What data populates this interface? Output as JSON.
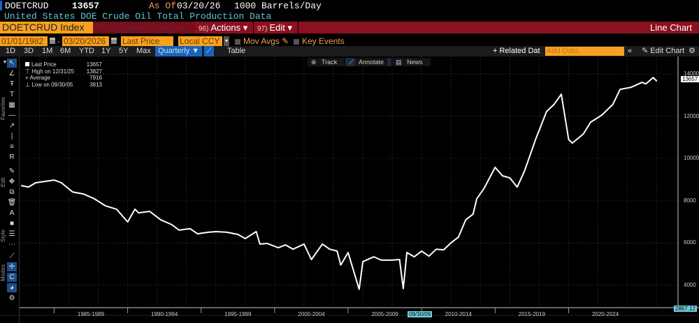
{
  "header": {
    "ticker": "DOETCRUD",
    "last": "13657",
    "as_of_label": "As Of",
    "as_of_date": "03/20/26",
    "units": "1000 Barrels/Day",
    "subtitle": "United States DOE Crude Oil Total Production Data"
  },
  "menubar": {
    "security": "DOETCRUD Index",
    "suggested_num": "94)",
    "suggested": "Suggested Charts",
    "actions_num": "96)",
    "actions": "Actions",
    "edit_num": "97)",
    "edit": "Edit",
    "chart_type": "Line Chart"
  },
  "controls": {
    "start_date": "01/01/1982",
    "end_date": "03/20/2026",
    "field": "Last Price",
    "currency": "Local CCY",
    "mov_avgs": "Mov Avgs",
    "key_events": "Key Events"
  },
  "periods": [
    "1D",
    "3D",
    "1M",
    "6M",
    "YTD",
    "1Y",
    "5Y",
    "Max"
  ],
  "frequency": "Quarterly ▼",
  "table_label": "Table",
  "related": "+ Related Dat",
  "add_data_placeholder": "Add Data",
  "edit_chart": "Edit Chart",
  "chart_tools": {
    "track": "Track",
    "annotate": "Annotate",
    "news": "News"
  },
  "side_labels": {
    "favorites": "Favorites",
    "edit": "Edit",
    "style": "Style",
    "modes": "Modes"
  },
  "legend": {
    "last_label": "Last Price",
    "last": "13657",
    "high_label": "High on 12/31/25",
    "high": "13827",
    "avg_label": "Average",
    "avg": "7916",
    "low_label": "Low on 09/30/05",
    "low": "3813"
  },
  "crosshair": {
    "x_label": "09/30/09",
    "y_label": "2867.12"
  },
  "chart_data": {
    "type": "line",
    "series_name": "Last Price",
    "line_color": "#ffffff",
    "ylim": [
      2500,
      14600
    ],
    "yticks": [
      4000,
      6000,
      8000,
      10000,
      12000,
      14000
    ],
    "xlim": [
      1982.0,
      2026.7
    ],
    "xticks": [
      "1985-1989",
      "1990-1994",
      "1995-1999",
      "2000-2004",
      "2005-2009",
      "2010-2014",
      "2015-2019",
      "2020-2024"
    ],
    "last_value_label": "13657",
    "points": [
      [
        1982.75,
        8720
      ],
      [
        1983.25,
        8650
      ],
      [
        1983.75,
        8850
      ],
      [
        1985.0,
        8980
      ],
      [
        1985.5,
        8850
      ],
      [
        1986.25,
        8420
      ],
      [
        1987.0,
        8320
      ],
      [
        1987.75,
        8090
      ],
      [
        1988.5,
        7760
      ],
      [
        1989.25,
        7600
      ],
      [
        1990.0,
        7000
      ],
      [
        1990.5,
        7600
      ],
      [
        1990.75,
        7430
      ],
      [
        1991.5,
        7500
      ],
      [
        1992.25,
        7100
      ],
      [
        1993.0,
        6870
      ],
      [
        1993.5,
        6610
      ],
      [
        1994.25,
        6680
      ],
      [
        1994.75,
        6440
      ],
      [
        1995.5,
        6510
      ],
      [
        1996.0,
        6540
      ],
      [
        1996.75,
        6510
      ],
      [
        1997.5,
        6410
      ],
      [
        1998.0,
        6210
      ],
      [
        1998.75,
        6540
      ],
      [
        1999.0,
        5950
      ],
      [
        1999.5,
        5980
      ],
      [
        2000.25,
        5780
      ],
      [
        2000.75,
        5910
      ],
      [
        2001.25,
        5710
      ],
      [
        2002.0,
        5950
      ],
      [
        2002.5,
        5220
      ],
      [
        2003.25,
        5950
      ],
      [
        2003.75,
        5710
      ],
      [
        2004.25,
        5620
      ],
      [
        2004.5,
        4960
      ],
      [
        2005.0,
        5550
      ],
      [
        2005.75,
        3813
      ],
      [
        2006.0,
        5120
      ],
      [
        2006.75,
        5350
      ],
      [
        2007.25,
        5190
      ],
      [
        2008.0,
        5190
      ],
      [
        2008.5,
        5220
      ],
      [
        2008.75,
        3840
      ],
      [
        2009.0,
        5550
      ],
      [
        2009.5,
        5350
      ],
      [
        2010.0,
        5620
      ],
      [
        2010.5,
        5380
      ],
      [
        2011.0,
        5710
      ],
      [
        2011.5,
        5680
      ],
      [
        2012.0,
        6010
      ],
      [
        2012.5,
        6280
      ],
      [
        2013.0,
        7100
      ],
      [
        2013.5,
        7370
      ],
      [
        2013.75,
        8090
      ],
      [
        2014.25,
        8590
      ],
      [
        2015.0,
        9580
      ],
      [
        2015.5,
        9180
      ],
      [
        2016.0,
        9080
      ],
      [
        2016.5,
        8650
      ],
      [
        2017.0,
        9410
      ],
      [
        2017.75,
        10900
      ],
      [
        2018.5,
        12220
      ],
      [
        2019.0,
        12550
      ],
      [
        2019.5,
        13040
      ],
      [
        2020.0,
        10900
      ],
      [
        2020.25,
        10730
      ],
      [
        2021.0,
        11160
      ],
      [
        2021.5,
        11720
      ],
      [
        2022.25,
        12050
      ],
      [
        2023.0,
        12550
      ],
      [
        2023.5,
        13270
      ],
      [
        2024.25,
        13370
      ],
      [
        2025.0,
        13600
      ],
      [
        2025.25,
        13530
      ],
      [
        2025.75,
        13827
      ],
      [
        2026.0,
        13657
      ]
    ]
  }
}
